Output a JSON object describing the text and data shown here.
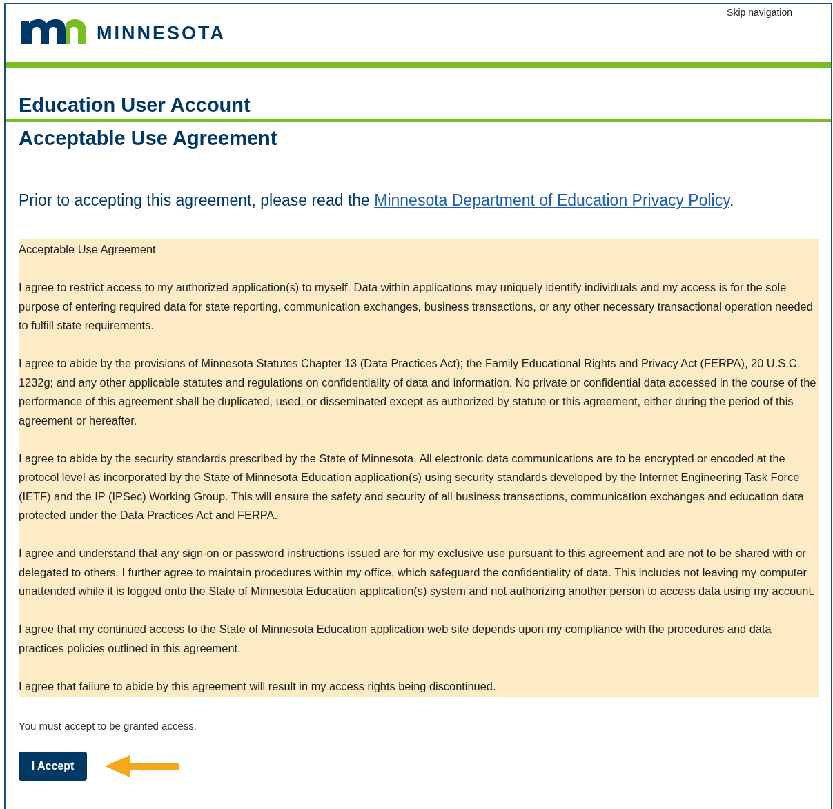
{
  "header": {
    "logo_text": "MINNESOTA",
    "skip_link": "Skip navigation"
  },
  "page_title": "Education User Account",
  "section_title": "Acceptable Use Agreement",
  "intro": {
    "text": "Prior to accepting this agreement, please read the ",
    "link": "Minnesota Department of Education Privacy Policy",
    "end": "."
  },
  "agreement": {
    "title": "Acceptable Use Agreement",
    "paragraphs": [
      "I agree to restrict access to my authorized application(s) to myself. Data within applications may uniquely identify individuals and my access is for the sole purpose of entering required data for state reporting, communication exchanges, business transactions, or any other necessary transactional operation needed to fulfill state requirements.",
      "I agree to abide by the provisions of Minnesota Statutes Chapter 13 (Data Practices Act); the Family Educational Rights and Privacy Act (FERPA), 20 U.S.C. 1232g; and any other applicable statutes and regulations on confidentiality of data and information. No private or confidential data accessed in the course of the performance of this agreement shall be duplicated, used, or disseminated except as authorized by statute or this agreement, either during the period of this agreement or hereafter.",
      "I agree to abide by the security standards prescribed by the State of Minnesota. All electronic data communications are to be encrypted or encoded at the protocol level as incorporated by the State of Minnesota Education application(s) using security standards developed by the Internet Engineering Task Force (IETF) and the IP (IPSec) Working Group. This will ensure the safety and security of all business transactions, communication exchanges and education data protected under the Data Practices Act and FERPA.",
      "I agree and understand that any sign-on or password instructions issued are for my exclusive use pursuant to this agreement and are not to be shared with or delegated to others. I further agree to maintain procedures within my office, which safeguard the confidentiality of data. This includes not leaving my computer unattended while it is logged onto the State of Minnesota Education application(s) system and not authorizing another person to access data using my account.",
      "I agree that my continued access to the State of Minnesota Education application web site depends upon my compliance with the procedures and data practices policies outlined in this agreement.",
      "I agree that failure to abide by this agreement will result in my access rights being discontinued."
    ]
  },
  "notice": "You must accept to be granted access.",
  "accept_button": "I Accept"
}
